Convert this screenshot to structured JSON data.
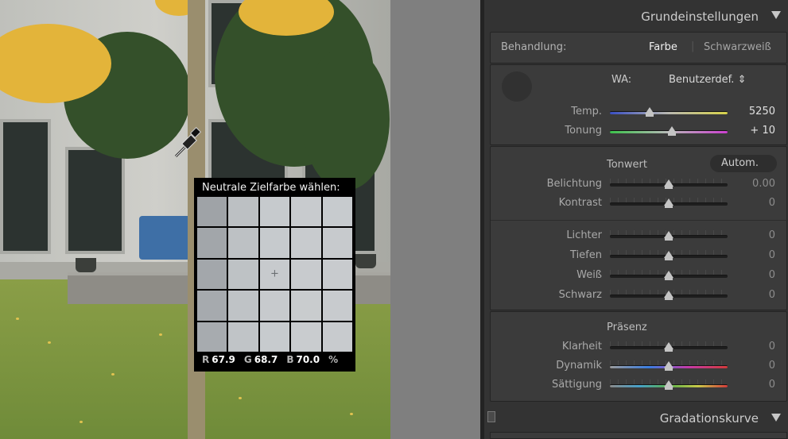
{
  "picker": {
    "title": "Neutrale Zielfarbe wählen:",
    "cells": [
      "#9fa3a7",
      "#bcc0c3",
      "#c6cacd",
      "#c8cbce",
      "#c7cbce",
      "#a2a6aa",
      "#bdc1c4",
      "#c6cacd",
      "#c8cbce",
      "#c7cacd",
      "#a3a7ab",
      "#bec2c5",
      "#c7cacd",
      "#c8cbce",
      "#c8cbce",
      "#a6aaae",
      "#bfc3c6",
      "#c7cacd",
      "#c9ccce",
      "#c8cbce",
      "#a7abaf",
      "#c0c4c7",
      "#c7cbce",
      "#c9cccf",
      "#c8cbce"
    ],
    "crosshair": "+",
    "r_label": "R",
    "r_value": "67.9",
    "g_label": "G",
    "g_value": "68.7",
    "b_label": "B",
    "b_value": "70.0",
    "unit": "%"
  },
  "panel": {
    "title": "Grundeinstellungen",
    "treatment": {
      "label": "Behandlung:",
      "option_color": "Farbe",
      "separator": "|",
      "option_bw": "Schwarzweiß"
    },
    "wb": {
      "label": "WA:",
      "value": "Benutzerdef. ⇕",
      "temp_label": "Temp.",
      "temp_value": "5250",
      "temp_position": 0.34,
      "tint_label": "Tonung",
      "tint_value": "+ 10",
      "tint_position": 0.53
    },
    "tone": {
      "heading": "Tonwert",
      "auto_label": "Autom.",
      "sliders": [
        {
          "name": "Belichtung",
          "value": "0.00",
          "position": 0.5
        },
        {
          "name": "Kontrast",
          "value": "0",
          "position": 0.5
        }
      ],
      "sliders2": [
        {
          "name": "Lichter",
          "value": "0",
          "position": 0.5
        },
        {
          "name": "Tiefen",
          "value": "0",
          "position": 0.5
        },
        {
          "name": "Weiß",
          "value": "0",
          "position": 0.5
        },
        {
          "name": "Schwarz",
          "value": "0",
          "position": 0.5
        }
      ]
    },
    "presence": {
      "heading": "Präsenz",
      "sliders": [
        {
          "name": "Klarheit",
          "value": "0",
          "position": 0.5
        },
        {
          "name": "Dynamik",
          "value": "0",
          "position": 0.5
        },
        {
          "name": "Sättigung",
          "value": "0",
          "position": 0.5
        }
      ]
    },
    "next_panel_title": "Gradationskurve",
    "colors": {
      "temp_gradient": [
        "#3a4fc4",
        "#b9b8b0",
        "#d7d24a"
      ],
      "tint_gradient": [
        "#3cc24b",
        "#b8b8b8",
        "#cc3fd0"
      ],
      "vib_gradient": [
        "#9a9a9a",
        "#3a7de0",
        "#c43aa8",
        "#d23a3a"
      ]
    }
  }
}
